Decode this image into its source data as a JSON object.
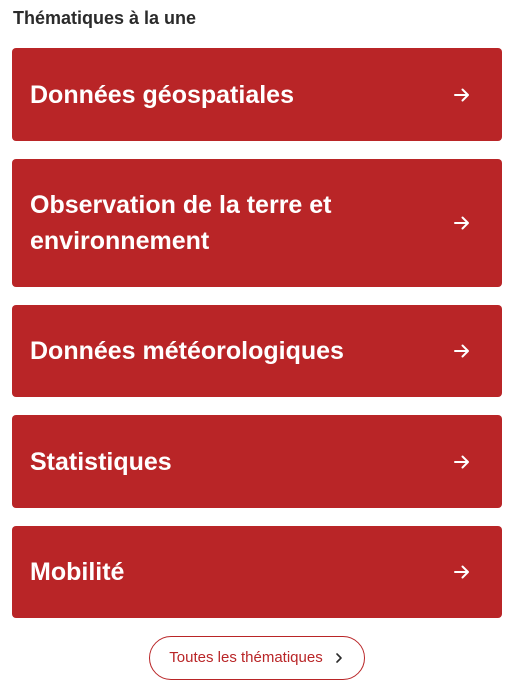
{
  "section": {
    "title": "Thématiques à la une"
  },
  "cards": [
    {
      "label": "Données géospatiales",
      "icon": "arrow-right-icon"
    },
    {
      "label": "Observation de la terre et environnement",
      "icon": "arrow-right-icon"
    },
    {
      "label": "Données météorologiques",
      "icon": "arrow-right-icon"
    },
    {
      "label": "Statistiques",
      "icon": "arrow-right-icon"
    },
    {
      "label": "Mobilité",
      "icon": "arrow-right-icon"
    }
  ],
  "all_button": {
    "label": "Toutes les thématiques",
    "icon": "chevron-right-icon"
  },
  "colors": {
    "accent": "#b92527",
    "card_text": "#ffffff",
    "title_text": "#2b2b2b"
  }
}
